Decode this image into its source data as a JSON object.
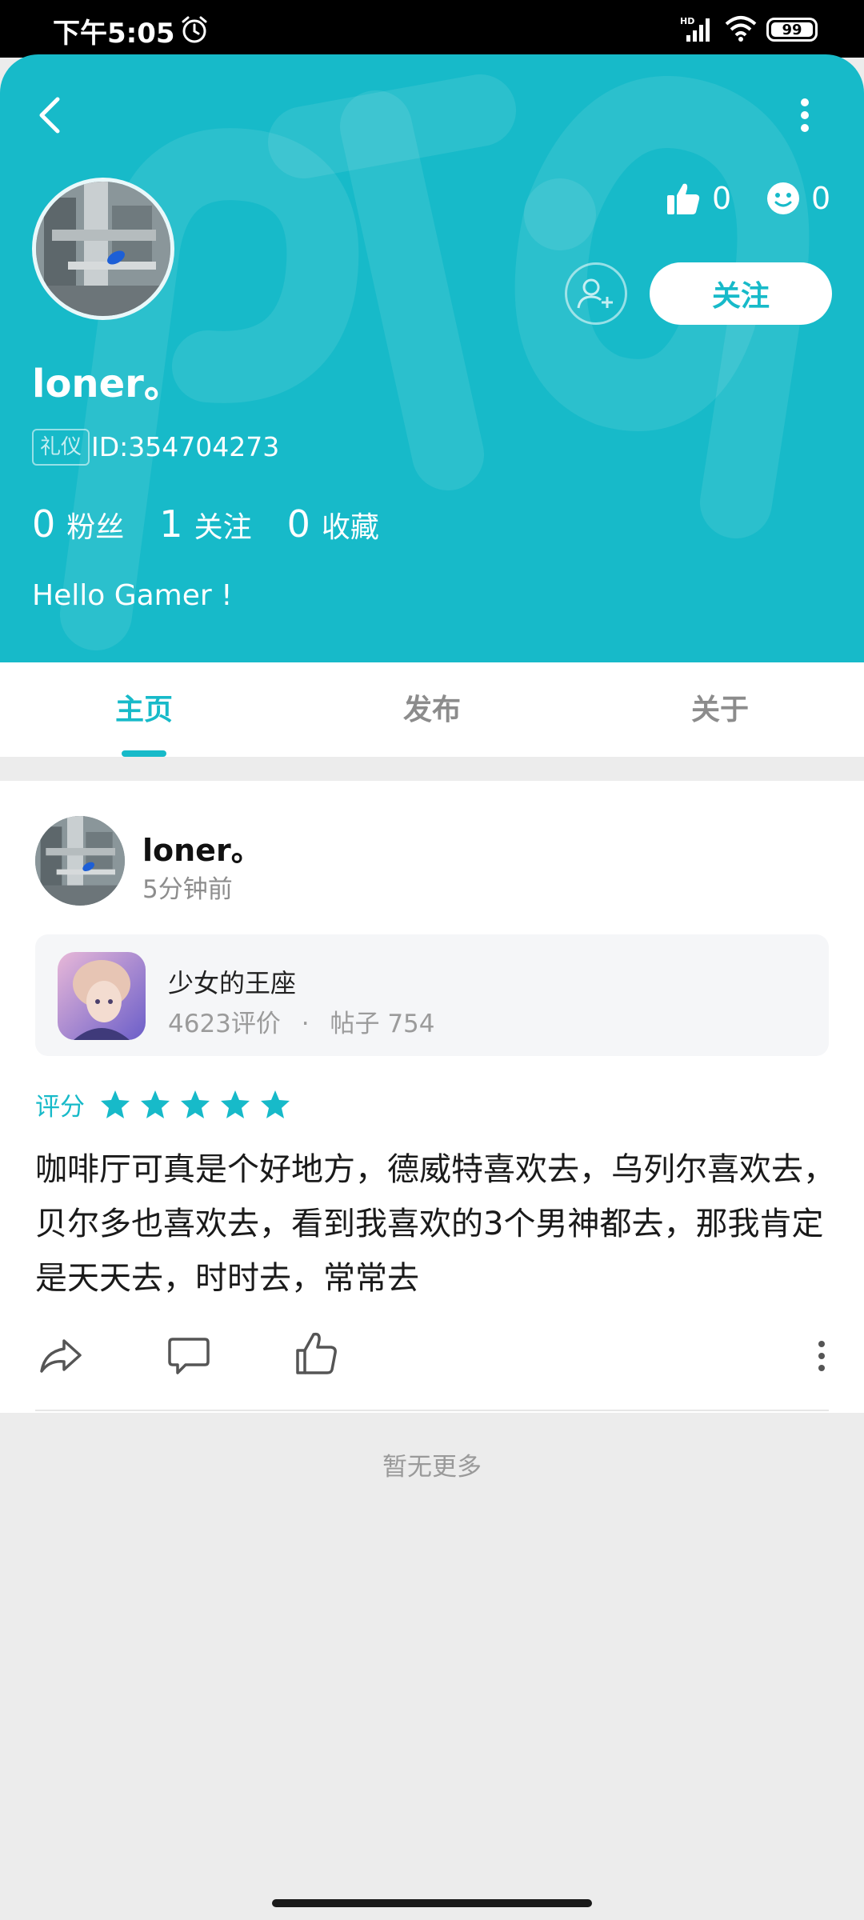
{
  "status_bar": {
    "time": "下午5:05",
    "battery": "99",
    "alarm_icon": "alarm-icon",
    "signal_icon": "hd-signal-icon",
    "wifi_icon": "wifi-icon"
  },
  "colors": {
    "accent": "#17bac9",
    "header_bg": "#17bac9",
    "page_bg": "#ececec"
  },
  "profile": {
    "username": "loner。",
    "badge": "礼仪",
    "user_id": "ID:354704273",
    "likes": "0",
    "smiles": "0",
    "follow_label": "关注",
    "bio": "Hello Gamer !",
    "counts": [
      {
        "value": "0",
        "label": "粉丝"
      },
      {
        "value": "1",
        "label": "关注"
      },
      {
        "value": "0",
        "label": "收藏"
      }
    ]
  },
  "tabs": [
    {
      "label": "主页",
      "active": true
    },
    {
      "label": "发布",
      "active": false
    },
    {
      "label": "关于",
      "active": false
    }
  ],
  "post": {
    "author": "loner。",
    "time": "5分钟前",
    "game": {
      "title": "少女的王座",
      "reviews": "4623评价",
      "separator": "·",
      "posts": "帖子 754"
    },
    "rating_label": "评分",
    "rating": 5,
    "rating_max": 5,
    "content": "咖啡厅可真是个好地方，德威特喜欢去，乌列尔喜欢去，贝尔多也喜欢去，看到我喜欢的3个男神都去，那我肯定是天天去，时时去，常常去"
  },
  "footer": {
    "no_more": "暂无更多"
  }
}
